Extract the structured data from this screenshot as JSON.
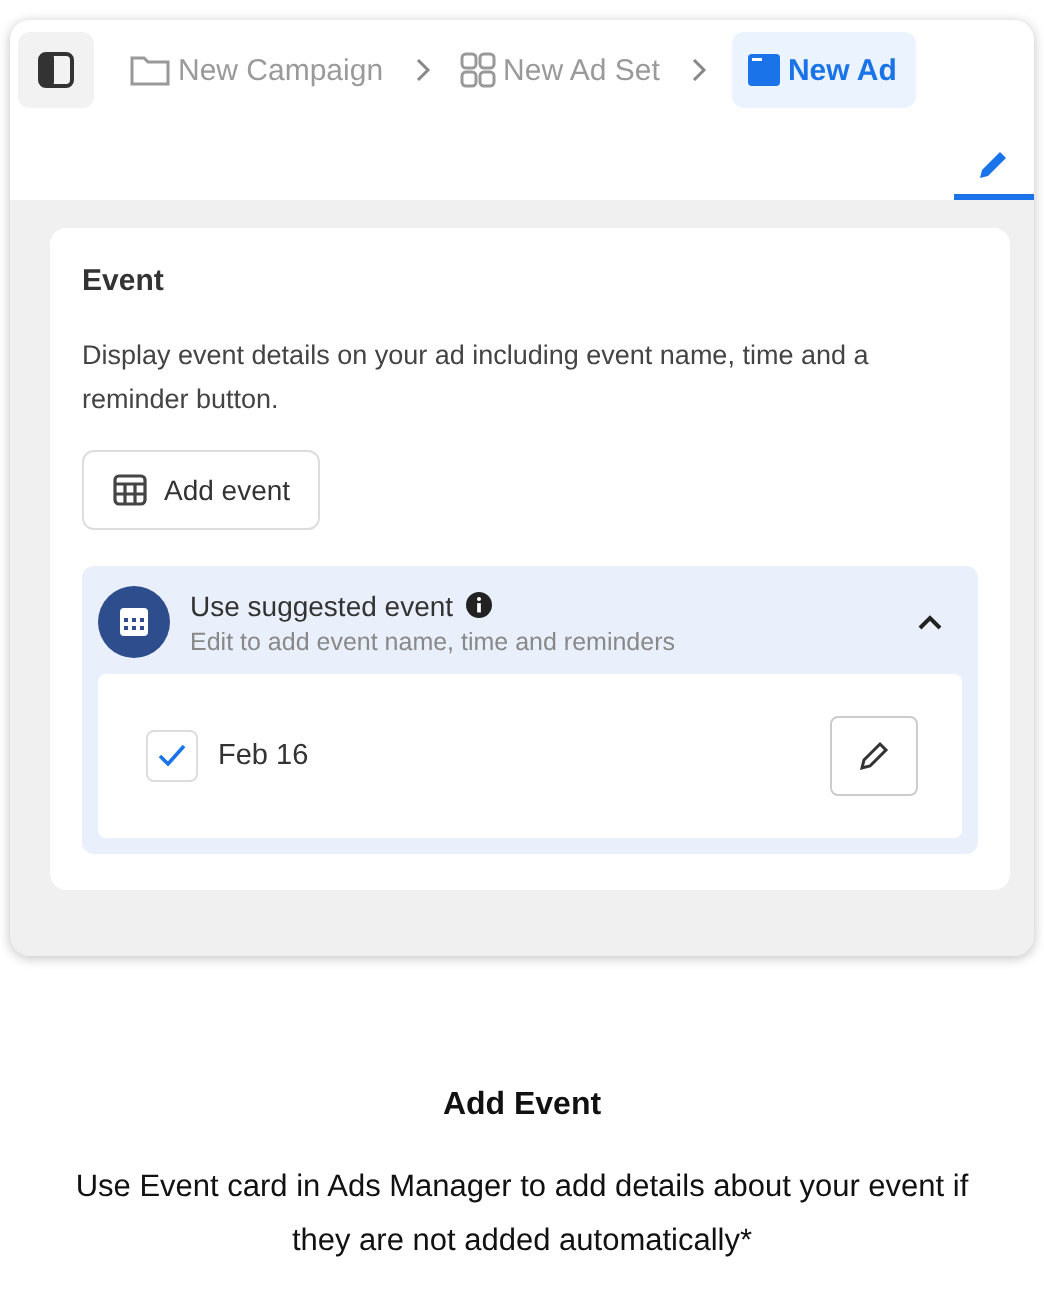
{
  "breadcrumbs": [
    {
      "kind": "campaign",
      "label": "New Campaign",
      "selected": false
    },
    {
      "kind": "adset",
      "label": "New Ad Set",
      "selected": false
    },
    {
      "kind": "ad",
      "label": "New Ad",
      "selected": true
    }
  ],
  "edit_tab": {
    "selected": true
  },
  "event_card": {
    "title": "Event",
    "description": "Display event details on your ad including event name, time and a reminder button.",
    "add_button": "Add event",
    "suggested": {
      "title": "Use suggested event",
      "subtitle": "Edit to add event name, time and reminders",
      "expanded": true,
      "item": {
        "label": "Feb 16",
        "checked": true
      }
    }
  },
  "caption": {
    "title": "Add Event",
    "text": "Use Event card in Ads Manager to add details about your event if they are not added automatically*"
  }
}
